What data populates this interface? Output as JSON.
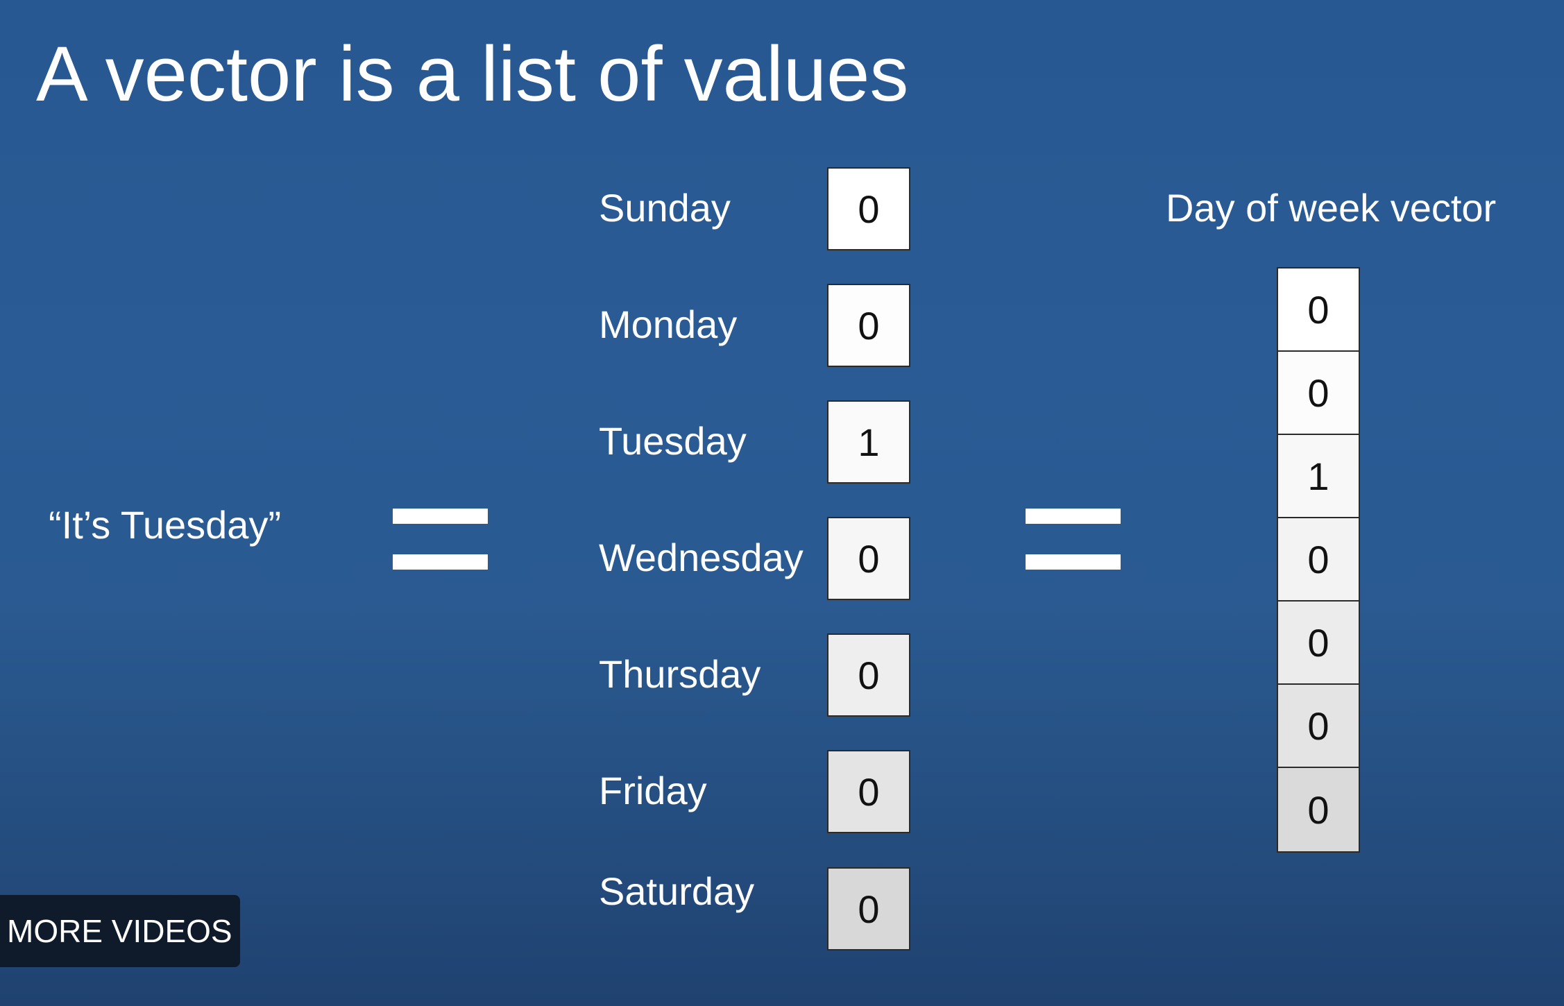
{
  "slide": {
    "title": "A vector is a list of values",
    "quote": "“It’s Tuesday”",
    "vector_title": "Day of week vector"
  },
  "days": [
    {
      "label": "Sunday",
      "value": "0"
    },
    {
      "label": "Monday",
      "value": "0"
    },
    {
      "label": "Tuesday",
      "value": "1"
    },
    {
      "label": "Wednesday",
      "value": "0"
    },
    {
      "label": "Thursday",
      "value": "0"
    },
    {
      "label": "Friday",
      "value": "0"
    },
    {
      "label": "Saturday",
      "value": "0"
    }
  ],
  "vector": [
    "0",
    "0",
    "1",
    "0",
    "0",
    "0",
    "0"
  ],
  "overlay": {
    "more_videos_label": "MORE VIDEOS"
  }
}
